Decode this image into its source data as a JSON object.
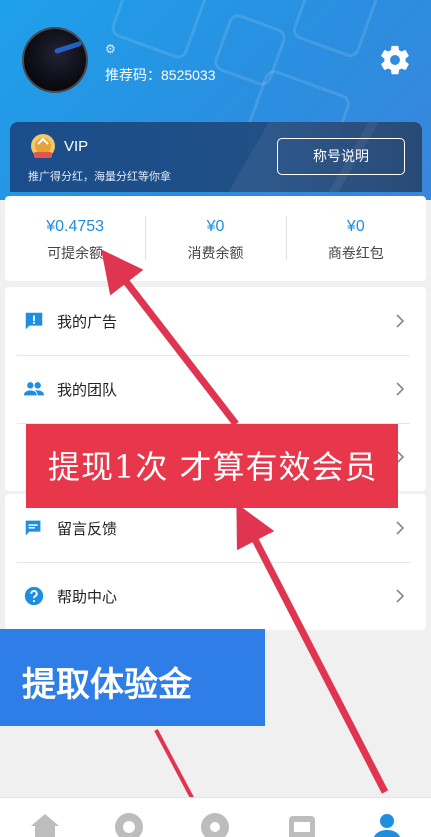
{
  "profile": {
    "gear_symbol": "⚙",
    "referral_label": "推荐码：",
    "referral_code": "8525033"
  },
  "vip": {
    "level": "VIP",
    "subtitle": "推广得分红，海量分红等你拿",
    "title_button": "称号说明"
  },
  "balances": [
    {
      "value": "¥0.4753",
      "label": "可提余额"
    },
    {
      "value": "¥0",
      "label": "消费余额"
    },
    {
      "value": "¥0",
      "label": "商卷红包"
    }
  ],
  "menu": {
    "ads": "我的广告",
    "team": "我的团队",
    "feedback": "留言反馈",
    "help": "帮助中心"
  },
  "overlays": {
    "red_banner": "提现1次 才算有效会员",
    "blue_banner": "提取体验金"
  },
  "colors": {
    "header_blue": "#1ea0ea",
    "accent_blue": "#1d8ee0",
    "vip_card": "#1a4e8a",
    "red_banner": "#e8374b",
    "blue_banner": "#2f7ee8",
    "arrow_red": "#e03550"
  },
  "icons": [
    "settings-icon",
    "vip-badge-icon",
    "ad-icon",
    "team-icon",
    "feedback-icon",
    "help-icon",
    "home-icon",
    "camera-icon",
    "store-icon",
    "profile-icon"
  ]
}
